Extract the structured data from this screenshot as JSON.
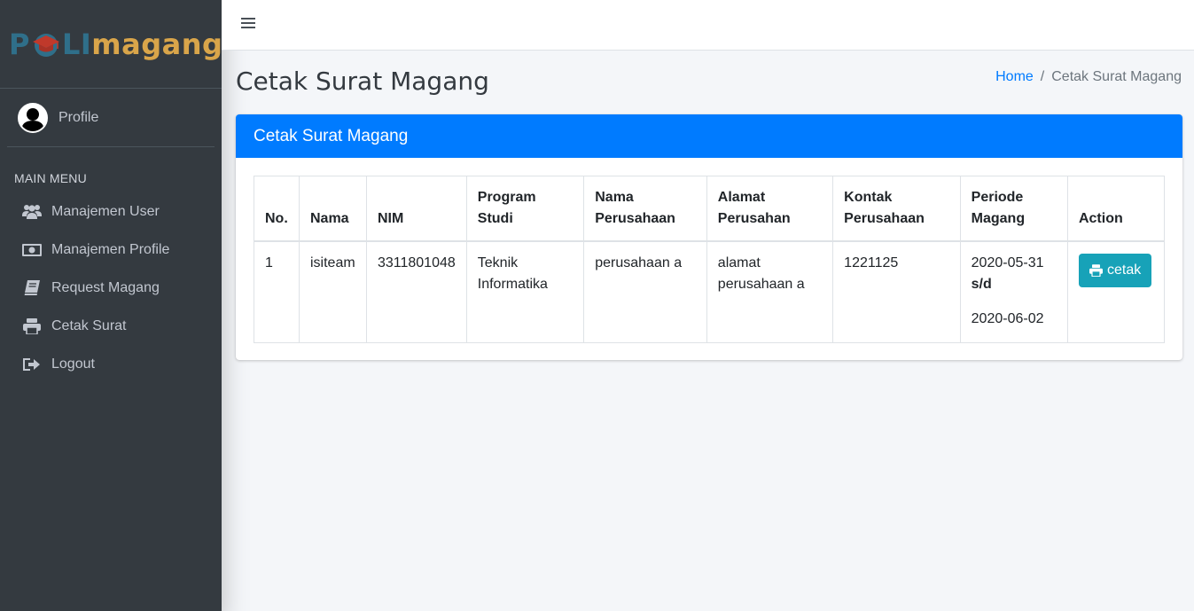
{
  "brand": {
    "left": "P",
    "mid": "LI",
    "right": "magang"
  },
  "user": {
    "label": "Profile"
  },
  "sidebar": {
    "header": "MAIN MENU",
    "items": [
      {
        "label": "Manajemen User",
        "icon": "users-icon"
      },
      {
        "label": "Manajemen Profile",
        "icon": "money-bill-icon"
      },
      {
        "label": "Request Magang",
        "icon": "book-icon"
      },
      {
        "label": "Cetak Surat",
        "icon": "print-icon"
      },
      {
        "label": "Logout",
        "icon": "sign-out-icon"
      }
    ]
  },
  "page": {
    "title": "Cetak Surat Magang",
    "breadcrumb": {
      "home": "Home",
      "sep": "/",
      "current": "Cetak Surat Magang"
    }
  },
  "card": {
    "title": "Cetak Surat Magang",
    "headers": {
      "no": "No.",
      "nama": "Nama",
      "nim": "NIM",
      "prodi_1": "Program",
      "prodi_2": "Studi",
      "perusahaan_1": "Nama",
      "perusahaan_2": "Perusahaan",
      "alamat_1": "Alamat",
      "alamat_2": "Perusahan",
      "kontak_1": "Kontak",
      "kontak_2": "Perusahaan",
      "periode_1": "Periode",
      "periode_2": "Magang",
      "action": "Action"
    },
    "rows": [
      {
        "no": "1",
        "nama": "isiteam",
        "nim": "3311801048",
        "prodi_1": "Teknik",
        "prodi_2": "Informatika",
        "perusahaan": "perusahaan a",
        "alamat_1": "alamat",
        "alamat_2": "perusahaan a",
        "kontak": "1221125",
        "periode_start": "2020-05-31",
        "periode_sep": "s/d",
        "periode_end": "2020-06-02",
        "action_label": "cetak"
      }
    ]
  },
  "colors": {
    "primary": "#007bff",
    "info": "#17a2b8",
    "sidebar": "#343a40"
  }
}
